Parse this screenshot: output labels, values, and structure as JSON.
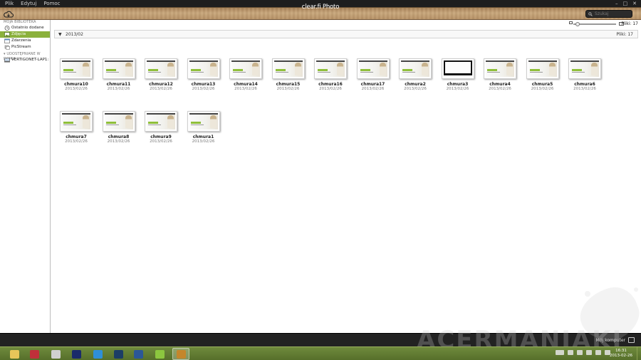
{
  "menu": {
    "items": [
      "Plik",
      "Edytuj",
      "Pomoc"
    ]
  },
  "app": {
    "title": "clear.fi Photo"
  },
  "window_controls": [
    "–",
    "□",
    "✕"
  ],
  "search": {
    "placeholder": "Szukaj"
  },
  "toolbar": {
    "file_count": "Pliki: 17"
  },
  "sidebar": {
    "library_heading": "MOJA BIBLIOTEKA",
    "library_items": [
      {
        "label": "Ostatnio dodane",
        "icon": "clock-icon"
      },
      {
        "label": "Zdjęcia",
        "icon": "photo-icon",
        "selected": true
      },
      {
        "label": "Zdarzenia",
        "icon": "calendar-icon"
      },
      {
        "label": "PicStream",
        "icon": "picstream-icon"
      }
    ],
    "shared_heading": "UDOSTĘPNIANE W DOMU",
    "shared_items": [
      {
        "label": "VERTIGONET-LAP1: Ve",
        "icon": "computer-icon"
      }
    ]
  },
  "group": {
    "arrow": "▼",
    "date": "2013/02",
    "count": "Pliki: 17"
  },
  "photos": [
    {
      "name": "chmura10",
      "date": "2013/02/26"
    },
    {
      "name": "chmura11",
      "date": "2013/02/26"
    },
    {
      "name": "chmura12",
      "date": "2013/02/26"
    },
    {
      "name": "chmura13",
      "date": "2013/02/26"
    },
    {
      "name": "chmura14",
      "date": "2013/02/26"
    },
    {
      "name": "chmura15",
      "date": "2013/02/26"
    },
    {
      "name": "chmura16",
      "date": "2013/02/26"
    },
    {
      "name": "chmura17",
      "date": "2013/02/26"
    },
    {
      "name": "chmura2",
      "date": "2013/02/26"
    },
    {
      "name": "chmura3",
      "date": "2013/02/26",
      "dark": true
    },
    {
      "name": "chmura4",
      "date": "2013/02/26"
    },
    {
      "name": "chmura5",
      "date": "2013/02/26"
    },
    {
      "name": "chmura6",
      "date": "2013/02/26"
    },
    {
      "name": "chmura7",
      "date": "2013/02/26"
    },
    {
      "name": "chmura8",
      "date": "2013/02/26"
    },
    {
      "name": "chmura9",
      "date": "2013/02/26"
    },
    {
      "name": "chmura1",
      "date": "2013/02/26"
    }
  ],
  "status": {
    "label": "Mój komputer"
  },
  "taskbar": {
    "apps": [
      {
        "name": "explorer-icon",
        "color": "#e8c659"
      },
      {
        "name": "shield-icon",
        "color": "#c0303a"
      },
      {
        "name": "paint-icon",
        "color": "#d0d0d0"
      },
      {
        "name": "chart-icon",
        "color": "#1a2a6a"
      },
      {
        "name": "ie-icon",
        "color": "#2f8fd8"
      },
      {
        "name": "photoshop-icon",
        "color": "#1c3d66"
      },
      {
        "name": "word-icon",
        "color": "#2b5797"
      },
      {
        "name": "cloud-icon",
        "color": "#8cc63f"
      },
      {
        "name": "clearfi-icon",
        "color": "#c4862c",
        "active": true
      }
    ],
    "clock_time": "16:31",
    "clock_date": "2013-02-26"
  },
  "watermark": "ACERMANIAKI",
  "colors": {
    "selection": "#8bb13c",
    "taskbar": "#5f7a32",
    "wood": "#c3a074"
  }
}
